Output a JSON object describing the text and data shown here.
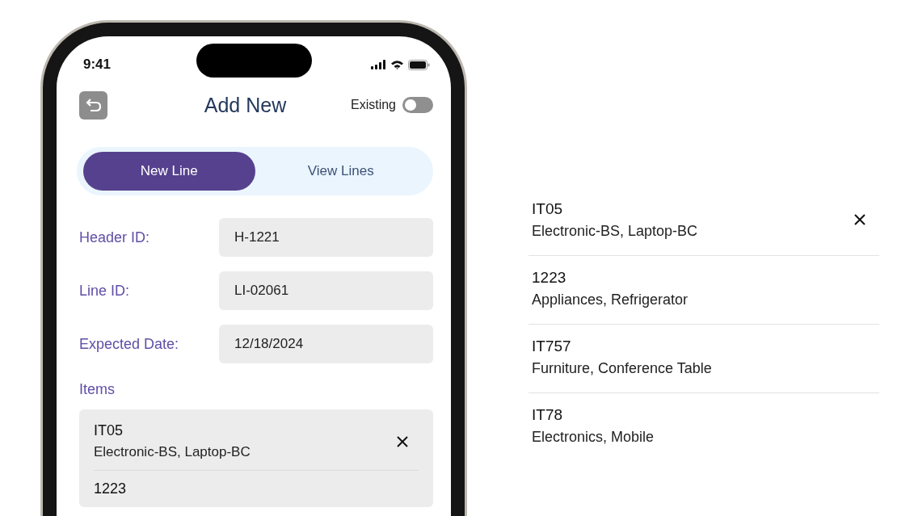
{
  "status_bar": {
    "time": "9:41"
  },
  "header": {
    "title": "Add New",
    "existing": {
      "label": "Existing",
      "on": false
    }
  },
  "tabs": [
    {
      "label": "New Line",
      "selected": true
    },
    {
      "label": "View Lines",
      "selected": false
    }
  ],
  "fields": [
    {
      "label": "Header ID:",
      "value": "H-1221"
    },
    {
      "label": "Line ID:",
      "value": "LI-02061"
    },
    {
      "label": "Expected Date:",
      "value": "12/18/2024"
    }
  ],
  "items_label": "Items",
  "items": [
    {
      "code": "IT05",
      "description": "Electronic-BS, Laptop-BC",
      "removable": true
    },
    {
      "code": "1223",
      "removable": false
    }
  ],
  "dropdown_items": [
    {
      "code": "IT05",
      "description": "Electronic-BS, Laptop-BC",
      "removable": true
    },
    {
      "code": "1223",
      "description": "Appliances, Refrigerator",
      "removable": false
    },
    {
      "code": "IT757",
      "description": "Furniture, Conference Table",
      "removable": false
    },
    {
      "code": "IT78",
      "description": "Electronics, Mobile",
      "removable": false
    }
  ]
}
